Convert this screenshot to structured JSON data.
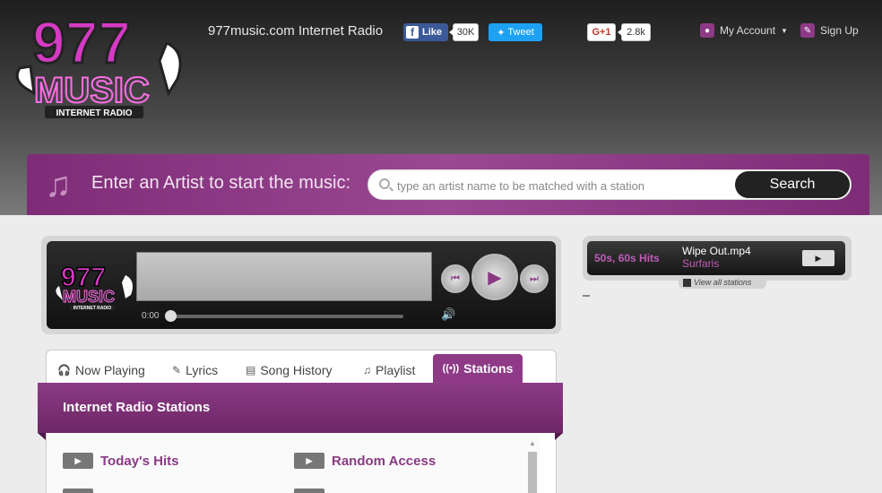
{
  "header": {
    "site_title": "977music.com Internet Radio",
    "facebook_label": "Like",
    "facebook_count": "30K",
    "tweet_label": "Tweet",
    "gplus_label": "G+1",
    "gplus_count": "2.8k",
    "my_account": "My Account",
    "sign_up": "Sign Up"
  },
  "logo": {
    "top": "977",
    "bottom": "MUSIC",
    "tagline": "INTERNET RADIO"
  },
  "search": {
    "prompt": "Enter an Artist to start the music:",
    "placeholder": "type an artist name to be matched with a station",
    "button": "Search"
  },
  "player": {
    "time": "0:00",
    "progress": 0
  },
  "now": {
    "genre": "50s, 60s Hits",
    "song": "Wipe Out.mp4",
    "artist": "Surfaris",
    "view_all": "View all stations"
  },
  "tabs": [
    {
      "label": "Now Playing"
    },
    {
      "label": "Lyrics"
    },
    {
      "label": "Song History"
    },
    {
      "label": "Playlist"
    },
    {
      "label": "Stations"
    }
  ],
  "stations_panel": {
    "title": "Internet Radio Stations",
    "items": [
      "Today's Hits",
      "Random Access"
    ]
  },
  "colors": {
    "brand_purple": "#8e3a87",
    "pink": "#c25bb8"
  },
  "icons": [
    "play-icon",
    "music-note-icon",
    "search-icon",
    "headphones-icon",
    "radio-icon"
  ]
}
